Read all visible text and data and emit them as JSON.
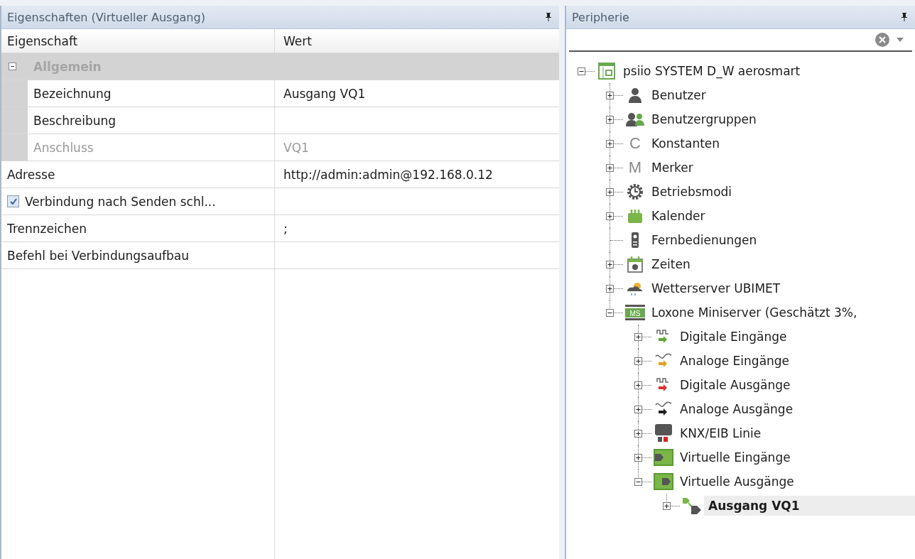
{
  "properties_panel": {
    "title": "Eigenschaften (Virtueller Ausgang)",
    "columns": [
      "Eigenschaft",
      "Wert"
    ],
    "rows": [
      {
        "kind": "category",
        "name": "Allgemein",
        "expanded": true,
        "children": [
          {
            "kind": "prop",
            "name": "Bezeichnung",
            "value": "Ausgang VQ1",
            "disabled": false
          },
          {
            "kind": "prop",
            "name": "Beschreibung",
            "disabled": false
          },
          {
            "kind": "prop",
            "name": "Anschluss",
            "value": "VQ1",
            "disabled": true
          }
        ]
      },
      {
        "kind": "prop",
        "name": "Adresse",
        "value": "http://admin:admin@192.168.0.12",
        "disabled": false
      },
      {
        "kind": "check",
        "name": "Verbindung nach Senden schl...",
        "checked": true
      },
      {
        "kind": "prop",
        "name": "Trennzeichen",
        "value": ";",
        "disabled": false
      },
      {
        "kind": "prop",
        "name": "Befehl bei Verbindungsaufbau",
        "disabled": false
      }
    ]
  },
  "peripherie_panel": {
    "title": "Peripherie",
    "tree": [
      {
        "label": "psiio SYSTEM D_W aerosmart",
        "kind": "system",
        "expanded": true,
        "selected": false,
        "children": [
          {
            "label": "Benutzer",
            "kind": "user",
            "expanded": false,
            "selected": false
          },
          {
            "label": "Benutzergruppen",
            "kind": "group",
            "expanded": false,
            "selected": false
          },
          {
            "label": "Konstanten",
            "kind": "letter",
            "glyph": "C",
            "expanded": false,
            "selected": false
          },
          {
            "label": "Merker",
            "kind": "letter",
            "glyph": "M",
            "expanded": false,
            "selected": false
          },
          {
            "label": "Betriebsmodi",
            "kind": "gear",
            "expanded": false,
            "selected": false
          },
          {
            "label": "Kalender",
            "kind": "calendar",
            "expanded": false,
            "selected": false
          },
          {
            "label": "Fernbedienungen",
            "kind": "remote",
            "selected": false
          },
          {
            "label": "Zeiten",
            "kind": "clock",
            "expanded": false,
            "selected": false
          },
          {
            "label": "Wetterserver UBIMET",
            "kind": "weather",
            "expanded": false,
            "selected": false
          },
          {
            "label": "Loxone Miniserver (Geschätzt 3%,",
            "kind": "server",
            "glyph": "MS",
            "expanded": true,
            "selected": false,
            "children": [
              {
                "label": "Digitale Eingänge",
                "kind": "digital",
                "color": "#5aa832",
                "expanded": false,
                "selected": false
              },
              {
                "label": "Analoge Eingänge",
                "kind": "analog",
                "color": "#e0a020",
                "expanded": false,
                "selected": false
              },
              {
                "label": "Digitale Ausgänge",
                "kind": "digital",
                "color": "#e03030",
                "expanded": false,
                "selected": false
              },
              {
                "label": "Analoge Ausgänge",
                "kind": "analog",
                "color": "#202020",
                "expanded": false,
                "selected": false
              },
              {
                "label": "KNX/EIB Linie",
                "kind": "knx",
                "expanded": false,
                "selected": false
              },
              {
                "label": "Virtuelle Eingänge",
                "kind": "virtual-in",
                "expanded": false,
                "selected": false
              },
              {
                "label": "Virtuelle Ausgänge",
                "kind": "virtual-out",
                "expanded": true,
                "selected": false,
                "children": [
                  {
                    "label": "Ausgang VQ1",
                    "kind": "vq",
                    "expanded": false,
                    "selected": true
                  }
                ]
              }
            ]
          }
        ]
      }
    ]
  }
}
